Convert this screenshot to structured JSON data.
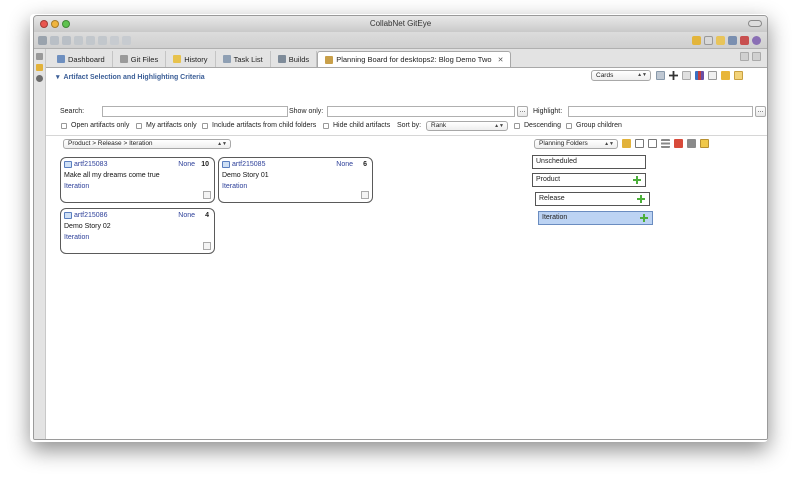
{
  "window": {
    "title": "CollabNet GitEye"
  },
  "tabs": [
    {
      "label": "Dashboard"
    },
    {
      "label": "Git Files"
    },
    {
      "label": "History"
    },
    {
      "label": "Task List"
    },
    {
      "label": "Builds"
    },
    {
      "label": "Planning Board for desktops2: Blog Demo Two"
    }
  ],
  "section": {
    "title": "Artifact Selection and Highlighting Criteria",
    "view_mode": "Cards"
  },
  "filters": {
    "search_label": "Search:",
    "show_only_label": "Show only:",
    "highlight_label": "Highlight:",
    "dots": "...",
    "open_artifacts": "Open artifacts only",
    "my_artifacts": "My artifacts only",
    "include_child": "Include artifacts from child folders",
    "hide_child": "Hide child artifacts",
    "sort_by_label": "Sort by:",
    "sort_by_value": "Rank",
    "descending": "Descending",
    "group_children": "Group children"
  },
  "hierarchy": {
    "path": "Product > Release > Iteration"
  },
  "planning": {
    "folders_select": "Planning Folders"
  },
  "cards": [
    {
      "id": "artf215083",
      "status": "None",
      "points": "10",
      "title": "Make all my dreams come true",
      "folder": "Iteration"
    },
    {
      "id": "artf215085",
      "status": "None",
      "points": "6",
      "title": "Demo Story 01",
      "folder": "Iteration"
    },
    {
      "id": "artf215086",
      "status": "None",
      "points": "4",
      "title": "Demo Story 02",
      "folder": "Iteration"
    }
  ],
  "folders": [
    {
      "label": "Unscheduled"
    },
    {
      "label": "Product"
    },
    {
      "label": "Release"
    },
    {
      "label": "Iteration"
    }
  ]
}
